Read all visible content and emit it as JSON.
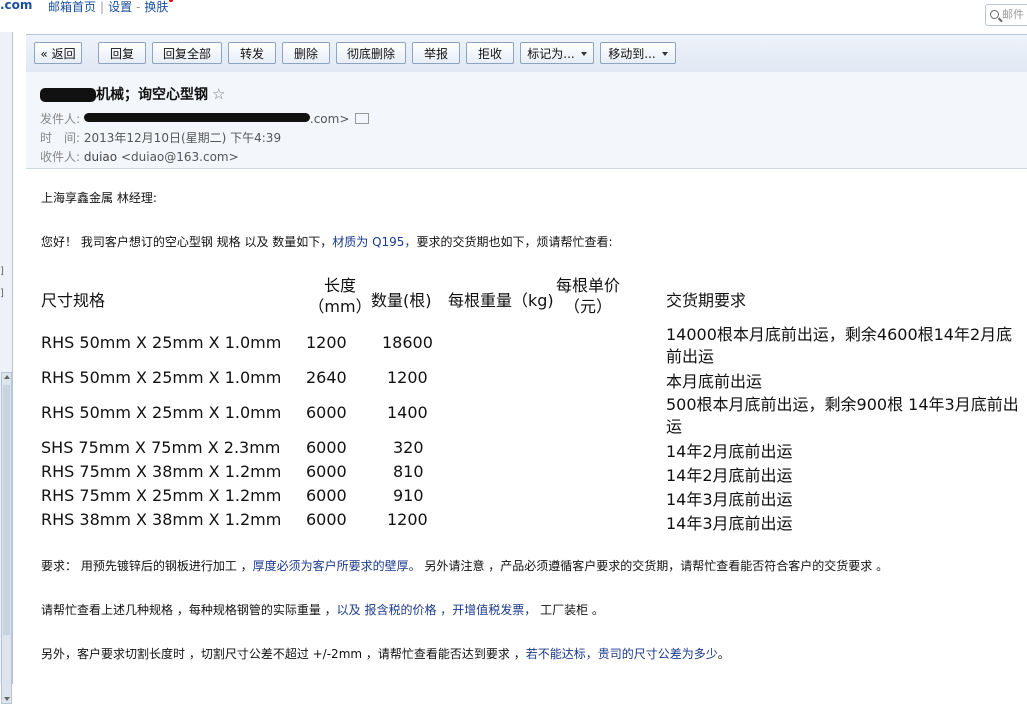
{
  "topbar": {
    "domain": ".com",
    "links": [
      "邮箱首页",
      "设置",
      "换肤"
    ],
    "search_placeholder": "邮件"
  },
  "toolbar": {
    "back": "« 返回",
    "reply": "回复",
    "reply_all": "回复全部",
    "forward": "转发",
    "delete": "删除",
    "delete_perm": "彻底删除",
    "report": "举报",
    "reject": "拒收",
    "mark_as": "标记为...",
    "move_to": "移动到..."
  },
  "header": {
    "subject": "机械；询空心型钢",
    "sender_label": "发件人:",
    "sender_suffix": ".com>",
    "time_label": "时　间:",
    "time_value": "2013年12月10日(星期二) 下午4:39",
    "recipient_label": "收件人:",
    "recipient_name": "duiao",
    "recipient_email": "<duiao@163.com>"
  },
  "body": {
    "greeting": "上海享鑫金属 林经理:",
    "intro_a": "您好！ 我司客户想订的空心型钢 规格 以及 数量如下，",
    "intro_b": "材质为 Q195，",
    "intro_c": "要求的交货期也如下，烦请帮忙查看:",
    "table": {
      "headers": {
        "spec": "尺寸规格",
        "length_1": "长度",
        "length_2": "（mm）",
        "qty": "数量(根)",
        "weight": "每根重量（kg)",
        "price_1": "每根单价",
        "price_2": "（元）",
        "delivery": "交货期要求"
      },
      "rows": [
        {
          "spec": "RHS 50mm X 25mm X 1.0mm",
          "length": "1200",
          "qty": "18600",
          "delivery_1": "14000根本月底前出运，剩余4600根14年2月底",
          "delivery_2": "前出运"
        },
        {
          "spec": "RHS 50mm X 25mm X 1.0mm",
          "length": "2640",
          "qty": "1200",
          "delivery_1": "本月底前出运",
          "delivery_2": ""
        },
        {
          "spec": "RHS 50mm X 25mm X 1.0mm",
          "length": "6000",
          "qty": "1400",
          "delivery_1": "500根本月底前出运，剩余900根 14年3月底前出",
          "delivery_2": "运"
        },
        {
          "spec": "SHS 75mm X 75mm X 2.3mm",
          "length": "6000",
          "qty": "320",
          "delivery_1": "14年2月底前出运",
          "delivery_2": ""
        },
        {
          "spec": "RHS 75mm X 38mm X 1.2mm",
          "length": "6000",
          "qty": "810",
          "delivery_1": "14年2月底前出运",
          "delivery_2": ""
        },
        {
          "spec": "RHS 75mm X 25mm X 1.2mm",
          "length": "6000",
          "qty": "910",
          "delivery_1": "14年3月底前出运",
          "delivery_2": ""
        },
        {
          "spec": "RHS 38mm X 38mm X 1.2mm",
          "length": "6000",
          "qty": "1200",
          "delivery_1": "14年3月底前出运",
          "delivery_2": ""
        }
      ]
    },
    "req_a": "要求： 用预先镀锌后的钢板进行加工 ，",
    "req_b": "厚度必须为客户所要求的壁厚。",
    "req_c": " 另外请注意 ，产品必须遵循客户要求的交货期，请帮忙查看能否符合客户的交货要求 。",
    "check_a": "请帮忙查看上述几种规格 ，每种规格钢管的实际重量 ，",
    "check_b": "以及 报含税的价格 ，开增值税发票，",
    "check_c": " 工厂装柜 。",
    "tol_a": "另外，客户要求切割长度时 ，切割尺寸公差不超过 +/-2mm ，请帮忙查看能否达到要求 ，",
    "tol_b": "若不能达标，贵司的尺寸公差为多少",
    "tol_c": "。"
  }
}
